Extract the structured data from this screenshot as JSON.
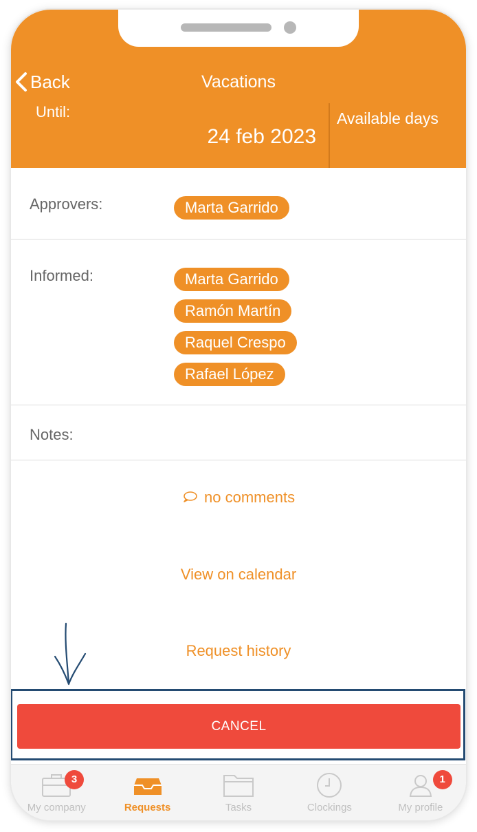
{
  "header": {
    "back_label": "Back",
    "title": "Vacations",
    "until_label": "Until:",
    "until_value": "24 feb 2023",
    "available_label": "Available days"
  },
  "approvers": {
    "label": "Approvers:",
    "people": [
      "Marta Garrido"
    ]
  },
  "informed": {
    "label": "Informed:",
    "people": [
      "Marta Garrido",
      "Ramón Martín",
      "Raquel Crespo",
      "Rafael López"
    ]
  },
  "notes": {
    "label": "Notes:"
  },
  "links": {
    "comments": "no comments",
    "calendar": "View on calendar",
    "history": "Request history"
  },
  "cancel_label": "CANCEL",
  "tabbar": {
    "items": [
      {
        "label": "My company",
        "icon": "briefcase-icon",
        "badge": "3"
      },
      {
        "label": "Requests",
        "icon": "inbox-tray-icon",
        "badge": ""
      },
      {
        "label": "Tasks",
        "icon": "folder-icon",
        "badge": ""
      },
      {
        "label": "Clockings",
        "icon": "clock-icon",
        "badge": ""
      },
      {
        "label": "My profile",
        "icon": "user-icon",
        "badge": "1"
      }
    ]
  },
  "colors": {
    "accent": "#ef9027",
    "danger": "#ef4a3c",
    "annotation": "#244b72"
  }
}
